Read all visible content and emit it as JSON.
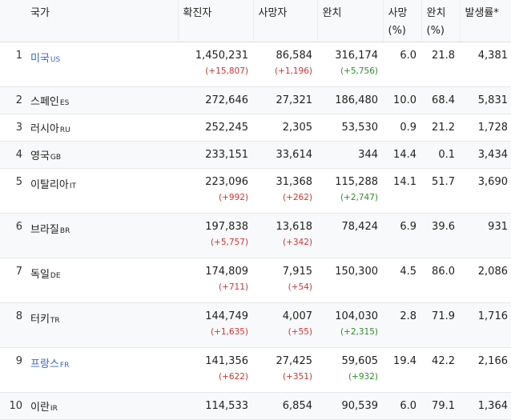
{
  "header": {
    "rank": "",
    "country": "국가",
    "confirmed": "확진자",
    "deaths": "사망자",
    "recovered": "완치",
    "death_rate_line1": "사망",
    "death_rate_line2": "(%)",
    "recovery_rate_line1": "완치",
    "recovery_rate_line2": "(%)",
    "incidence": "발생률*"
  },
  "colors": {
    "link": "#3366cc",
    "increase": "#d33333",
    "recovery_increase": "#2e8b2e",
    "header_bg": "#f8f9fa",
    "alt_row_bg": "#f8f9fa"
  },
  "rows": [
    {
      "rank": "1",
      "name": "미국",
      "code": "US",
      "link": true,
      "confirmed": "1,450,231",
      "confirmed_delta": "(+15,807)",
      "deaths": "86,584",
      "deaths_delta": "(+1,196)",
      "recovered": "316,174",
      "recovered_delta": "(+5,756)",
      "death_rate": "6.0",
      "recovery_rate": "21.8",
      "incidence": "4,381"
    },
    {
      "rank": "2",
      "name": "스페인",
      "code": "ES",
      "link": false,
      "confirmed": "272,646",
      "confirmed_delta": "",
      "deaths": "27,321",
      "deaths_delta": "",
      "recovered": "186,480",
      "recovered_delta": "",
      "death_rate": "10.0",
      "recovery_rate": "68.4",
      "incidence": "5,831"
    },
    {
      "rank": "3",
      "name": "러시아",
      "code": "RU",
      "link": false,
      "confirmed": "252,245",
      "confirmed_delta": "",
      "deaths": "2,305",
      "deaths_delta": "",
      "recovered": "53,530",
      "recovered_delta": "",
      "death_rate": "0.9",
      "recovery_rate": "21.2",
      "incidence": "1,728"
    },
    {
      "rank": "4",
      "name": "영국",
      "code": "GB",
      "link": false,
      "confirmed": "233,151",
      "confirmed_delta": "",
      "deaths": "33,614",
      "deaths_delta": "",
      "recovered": "344",
      "recovered_delta": "",
      "death_rate": "14.4",
      "recovery_rate": "0.1",
      "incidence": "3,434"
    },
    {
      "rank": "5",
      "name": "이탈리아",
      "code": "IT",
      "link": false,
      "confirmed": "223,096",
      "confirmed_delta": "(+992)",
      "deaths": "31,368",
      "deaths_delta": "(+262)",
      "recovered": "115,288",
      "recovered_delta": "(+2,747)",
      "death_rate": "14.1",
      "recovery_rate": "51.7",
      "incidence": "3,690"
    },
    {
      "rank": "6",
      "name": "브라질",
      "code": "BR",
      "link": false,
      "confirmed": "197,838",
      "confirmed_delta": "(+5,757)",
      "deaths": "13,618",
      "deaths_delta": "(+342)",
      "recovered": "78,424",
      "recovered_delta": "",
      "death_rate": "6.9",
      "recovery_rate": "39.6",
      "incidence": "931"
    },
    {
      "rank": "7",
      "name": "독일",
      "code": "DE",
      "link": false,
      "confirmed": "174,809",
      "confirmed_delta": "(+711)",
      "deaths": "7,915",
      "deaths_delta": "(+54)",
      "recovered": "150,300",
      "recovered_delta": "",
      "death_rate": "4.5",
      "recovery_rate": "86.0",
      "incidence": "2,086"
    },
    {
      "rank": "8",
      "name": "터키",
      "code": "TR",
      "link": false,
      "confirmed": "144,749",
      "confirmed_delta": "(+1,635)",
      "deaths": "4,007",
      "deaths_delta": "(+55)",
      "recovered": "104,030",
      "recovered_delta": "(+2,315)",
      "death_rate": "2.8",
      "recovery_rate": "71.9",
      "incidence": "1,716"
    },
    {
      "rank": "9",
      "name": "프랑스",
      "code": "FR",
      "link": true,
      "confirmed": "141,356",
      "confirmed_delta": "(+622)",
      "deaths": "27,425",
      "deaths_delta": "(+351)",
      "recovered": "59,605",
      "recovered_delta": "(+932)",
      "death_rate": "19.4",
      "recovery_rate": "42.2",
      "incidence": "2,166"
    },
    {
      "rank": "10",
      "name": "이란",
      "code": "IR",
      "link": false,
      "confirmed": "114,533",
      "confirmed_delta": "",
      "deaths": "6,854",
      "deaths_delta": "",
      "recovered": "90,539",
      "recovered_delta": "",
      "death_rate": "6.0",
      "recovery_rate": "79.1",
      "incidence": "1,364"
    }
  ]
}
